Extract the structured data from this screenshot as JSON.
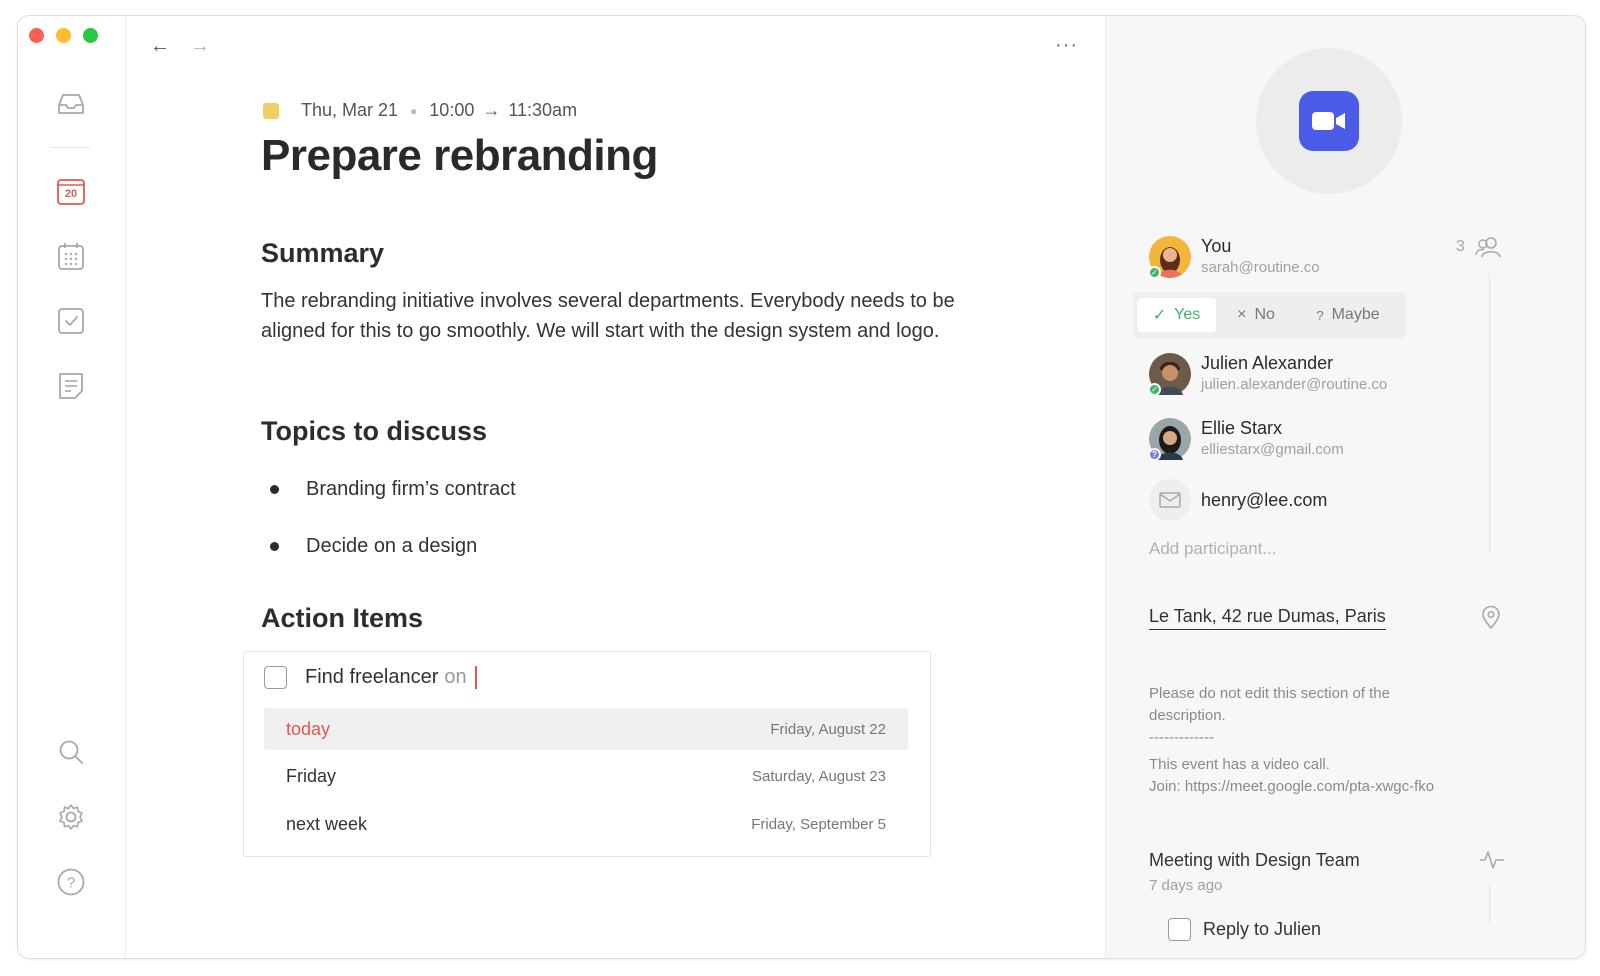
{
  "nav": {
    "inbox_icon": "inbox-icon",
    "calendar_day": "20",
    "calendar_icon": "calendar-grid-icon",
    "tasks_icon": "checkbox-icon",
    "notes_icon": "note-icon",
    "search_icon": "search-icon",
    "settings_icon": "gear-icon",
    "help_icon": "help-icon",
    "back_glyph": "←",
    "forward_glyph": "→",
    "more_glyph": "···"
  },
  "event": {
    "date": "Thu, Mar 21",
    "time_start": "10:00",
    "time_arrow": "→",
    "time_end": "11:30am",
    "color": "#f2cf63",
    "title": "Prepare rebranding"
  },
  "summary": {
    "heading": "Summary",
    "text": "The rebranding initiative involves several departments. Everybody needs to be aligned for this to go smoothly. We will start with the design system and logo."
  },
  "topics": {
    "heading": "Topics to discuss",
    "items": [
      "Branding firm’s contract",
      "Decide on a design"
    ]
  },
  "action_items": {
    "heading": "Action Items",
    "input_text": "Find freelancer",
    "input_suffix": "on",
    "suggestions": [
      {
        "label": "today",
        "date": "Friday, August 22"
      },
      {
        "label": "Friday",
        "date": "Saturday, August 23"
      },
      {
        "label": "next week",
        "date": "Friday, September 5"
      }
    ]
  },
  "panel": {
    "participant_count": "3",
    "participants": [
      {
        "name": "You",
        "email": "sarah@routine.co",
        "status": "accepted"
      },
      {
        "name": "Julien Alexander",
        "email": "julien.alexander@routine.co",
        "status": "accepted"
      },
      {
        "name": "Ellie Starx",
        "email": "elliestarx@gmail.com",
        "status": "maybe"
      }
    ],
    "rsvp": {
      "yes": "Yes",
      "no": "No",
      "maybe": "Maybe",
      "yes_glyph": "✓",
      "no_glyph": "×",
      "maybe_glyph": "?",
      "selected": "yes"
    },
    "invitee_email": "henry@lee.com",
    "add_placeholder": "Add participant...",
    "location": "Le Tank, 42 rue Dumas, Paris",
    "description": {
      "line1": "Please do not edit this section of the",
      "line2": "description.",
      "divider": "-------------",
      "line3": "This event has a video call.",
      "line4": "Join: https://meet.google.com/pta-xwgc-fko"
    },
    "activity": {
      "title": "Meeting with Design Team",
      "time": "7 days ago"
    },
    "reply_task": "Reply to Julien",
    "accent_green": "#3fb46a",
    "accent_red": "#e0584f",
    "video_color": "#4a5ce8"
  }
}
